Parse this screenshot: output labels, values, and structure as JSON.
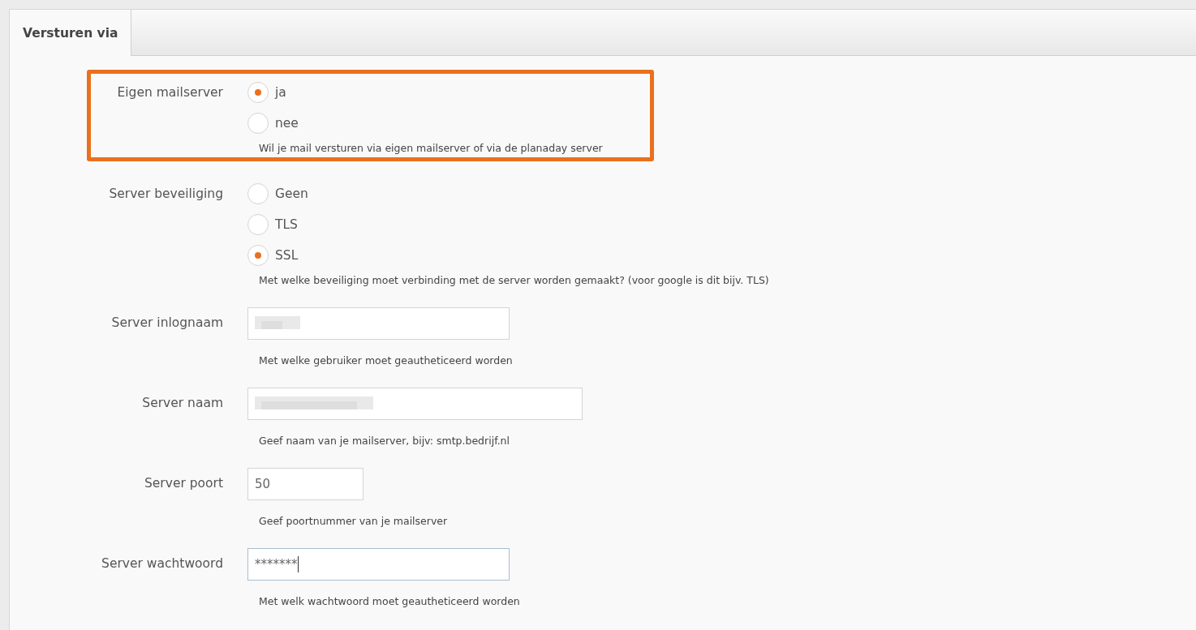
{
  "tabs": [
    {
      "label": "Versturen via",
      "selected": true
    }
  ],
  "fields": [
    {
      "kind": "radio",
      "label": "Eigen mailserver",
      "highlighted": true,
      "options": [
        {
          "label": "ja",
          "selected": true
        },
        {
          "label": "nee",
          "selected": false
        }
      ],
      "help": "Wil je mail versturen via eigen mailserver of via de planaday server"
    },
    {
      "kind": "radio",
      "label": "Server beveiliging",
      "highlighted": false,
      "options": [
        {
          "label": "Geen",
          "selected": false
        },
        {
          "label": "TLS",
          "selected": false
        },
        {
          "label": "SSL",
          "selected": true
        }
      ],
      "help": "Met welke beveiliging moet verbinding met de server worden gemaakt? (voor google is dit bijv. TLS)"
    },
    {
      "kind": "text",
      "label": "Server inlognaam",
      "highlighted": false,
      "redacted": true,
      "focused": false,
      "help": "Met welke gebruiker moet geautheticeerd worden"
    },
    {
      "kind": "text",
      "label": "Server naam",
      "highlighted": false,
      "redacted": true,
      "focused": false,
      "help": "Geef naam van je mailserver, bijv: smtp.bedrijf.nl"
    },
    {
      "kind": "text",
      "label": "Server poort",
      "highlighted": false,
      "redacted": false,
      "focused": false,
      "value": "50",
      "help": "Geef poortnummer van je mailserver"
    },
    {
      "kind": "text",
      "label": "Server wachtwoord",
      "highlighted": false,
      "redacted": false,
      "focused": true,
      "value": "*******",
      "help": "Met welk wachtwoord moet geautheticeerd worden"
    }
  ]
}
